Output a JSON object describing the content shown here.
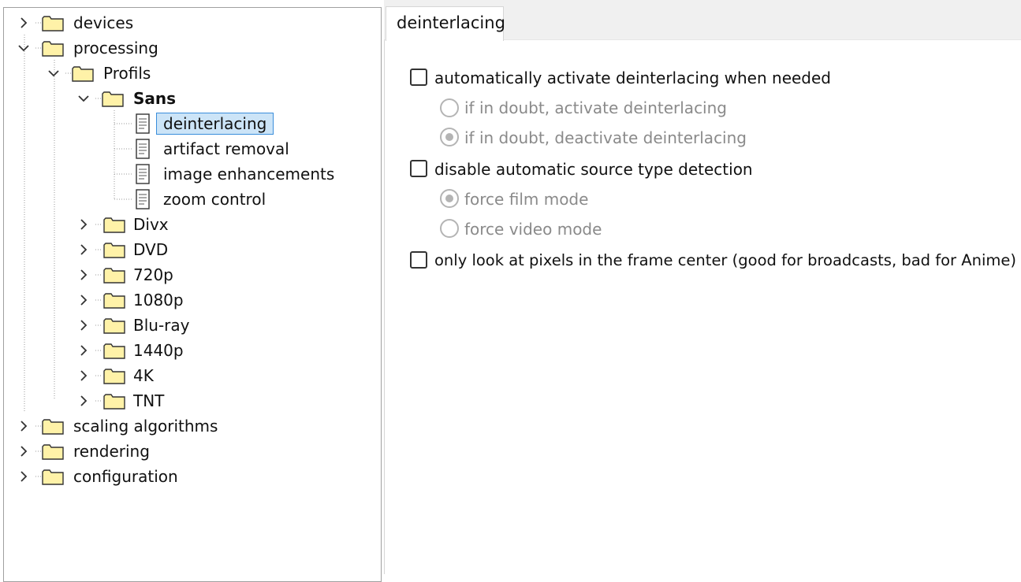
{
  "tree": {
    "items": [
      {
        "label": "devices"
      },
      {
        "label": "processing"
      },
      {
        "label": "Profils"
      },
      {
        "label": "Sans"
      },
      {
        "label": "deinterlacing"
      },
      {
        "label": "artifact removal"
      },
      {
        "label": "image enhancements"
      },
      {
        "label": "zoom control"
      },
      {
        "label": "Divx"
      },
      {
        "label": "DVD"
      },
      {
        "label": "720p"
      },
      {
        "label": "1080p"
      },
      {
        "label": "Blu-ray"
      },
      {
        "label": "1440p"
      },
      {
        "label": "4K"
      },
      {
        "label": "TNT"
      },
      {
        "label": "scaling algorithms"
      },
      {
        "label": "rendering"
      },
      {
        "label": "configuration"
      }
    ]
  },
  "tab": {
    "label": "deinterlacing"
  },
  "options": {
    "auto_deint": {
      "label": "automatically activate deinterlacing when needed",
      "checked": false
    },
    "doubt_activate": {
      "label": "if in doubt, activate deinterlacing",
      "checked": false
    },
    "doubt_deactivate": {
      "label": "if in doubt, deactivate deinterlacing",
      "checked": true
    },
    "disable_detect": {
      "label": "disable automatic source type detection",
      "checked": false
    },
    "film_mode": {
      "label": "force film mode",
      "checked": true
    },
    "video_mode": {
      "label": "force video mode",
      "checked": false
    },
    "center_pixels": {
      "label": "only look at pixels in the frame center  (good for broadcasts, bad for Anime)",
      "checked": false
    }
  },
  "colors": {
    "folder_fill": "#fff2a8",
    "folder_stroke": "#333333",
    "selection_fill": "#cce4f7",
    "selection_border": "#3a8edb"
  }
}
